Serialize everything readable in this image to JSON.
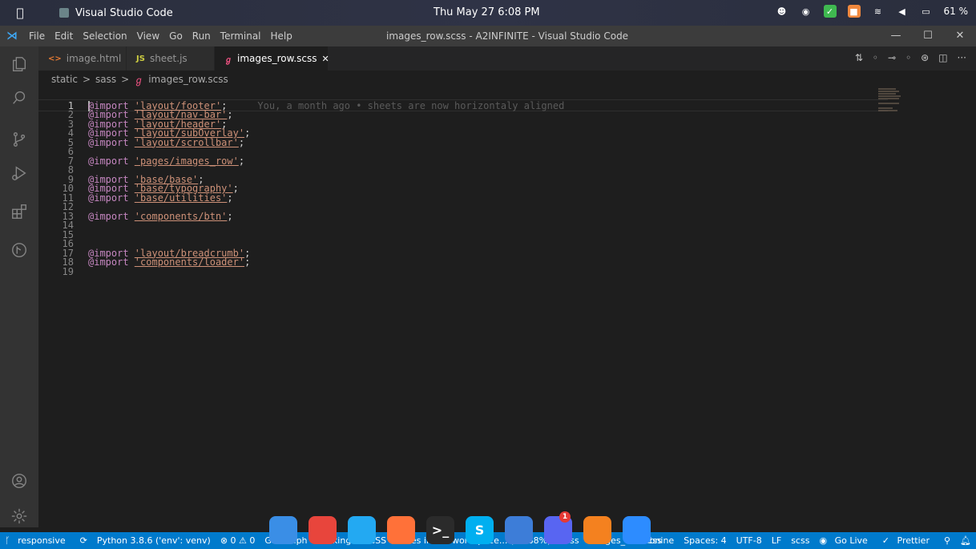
{
  "system": {
    "app_name": "Visual Studio Code",
    "clock": "Thu May 27  6:08 PM",
    "battery": "61 %"
  },
  "window": {
    "title": "images_row.scss - A2INFINITE - Visual Studio Code",
    "menu": [
      "File",
      "Edit",
      "Selection",
      "View",
      "Go",
      "Run",
      "Terminal",
      "Help"
    ]
  },
  "tabs": [
    {
      "label": "image.html",
      "icon": "<>",
      "active": false
    },
    {
      "label": "sheet.js",
      "icon": "JS",
      "active": false
    },
    {
      "label": "images_row.scss",
      "icon": "scss",
      "active": true,
      "close": "✕"
    }
  ],
  "breadcrumb": {
    "parts": [
      "static",
      "sass",
      "images_row.scss"
    ],
    "sep": ">"
  },
  "editor": {
    "blame": "You, a month ago • sheets are now horizontaly aligned",
    "lines": [
      {
        "n": "1",
        "kw": "@import",
        "str": "'layout/footer'",
        "p": ";"
      },
      {
        "n": "2",
        "kw": "@import",
        "str": "'layout/nav-bar'",
        "p": ";"
      },
      {
        "n": "3",
        "kw": "@import",
        "str": "'layout/header'",
        "p": ";"
      },
      {
        "n": "4",
        "kw": "@import",
        "str": "'layout/subOverlay'",
        "p": ";"
      },
      {
        "n": "5",
        "kw": "@import",
        "str": "'layout/scrollbar'",
        "p": ";"
      },
      {
        "n": "6",
        "kw": "",
        "str": "",
        "p": ""
      },
      {
        "n": "7",
        "kw": "@import",
        "str": "'pages/images_row'",
        "p": ";"
      },
      {
        "n": "8",
        "kw": "",
        "str": "",
        "p": ""
      },
      {
        "n": "9",
        "kw": "@import",
        "str": "'base/base'",
        "p": ";"
      },
      {
        "n": "10",
        "kw": "@import",
        "str": "'base/typography'",
        "p": ";"
      },
      {
        "n": "11",
        "kw": "@import",
        "str": "'base/utilities'",
        "p": ";"
      },
      {
        "n": "12",
        "kw": "",
        "str": "",
        "p": ""
      },
      {
        "n": "13",
        "kw": "@import",
        "str": "'components/btn'",
        "p": ";"
      },
      {
        "n": "14",
        "kw": "",
        "str": "",
        "p": ""
      },
      {
        "n": "15",
        "kw": "",
        "str": "",
        "p": ""
      },
      {
        "n": "16",
        "kw": "",
        "str": "",
        "p": ""
      },
      {
        "n": "17",
        "kw": "@import",
        "str": "'layout/breadcrumb'",
        "p": ";"
      },
      {
        "n": "18",
        "kw": "@import",
        "str": "'components/loader'",
        "p": ";"
      },
      {
        "n": "19",
        "kw": "",
        "str": "",
        "p": ""
      }
    ]
  },
  "status": {
    "branch": "responsive",
    "python": "Python 3.8.6 ('env': venv)",
    "problems": "⊗ 0 ⚠ 0",
    "git_graph": "Git Graph",
    "looking": "Looking for CSS classes in the workspace... (95.88%)",
    "scss": "scss",
    "file": "images_row.scss",
    "tabnine": "tabnine",
    "spaces": "Spaces: 4",
    "encoding": "UTF-8",
    "eol": "LF",
    "language": "scss",
    "golive": "Go Live",
    "prettier": "Prettier"
  },
  "dock": {
    "items": [
      {
        "name": "finder",
        "color": "#3a8ee6"
      },
      {
        "name": "chrome",
        "color": "#e8453c"
      },
      {
        "name": "vscode",
        "color": "#23a9f2"
      },
      {
        "name": "firefox",
        "color": "#ff7139"
      },
      {
        "name": "terminal",
        "color": "#2b2b2b",
        "glyph": ">_"
      },
      {
        "name": "skype",
        "color": "#00aff0",
        "glyph": "S"
      },
      {
        "name": "bookmarks",
        "color": "#3d7dd8"
      },
      {
        "name": "discord",
        "color": "#5865f2",
        "badge": "1"
      },
      {
        "name": "vlc",
        "color": "#f4811f"
      },
      {
        "name": "zoom",
        "color": "#2d8cff"
      }
    ]
  },
  "colors": {
    "statusbar": "#007acc",
    "editor_bg": "#1e1e1e",
    "keyword": "#c586c0",
    "string": "#ce9178"
  }
}
